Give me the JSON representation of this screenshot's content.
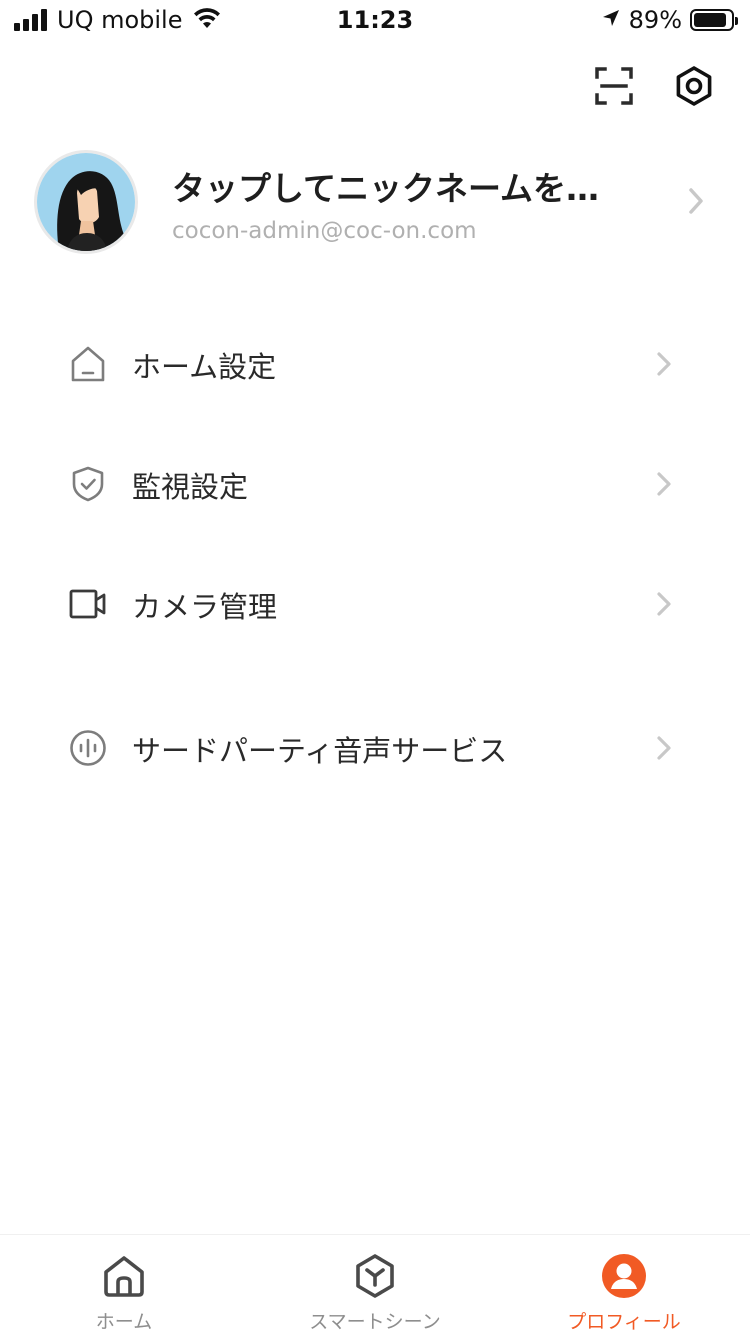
{
  "status_bar": {
    "carrier": "UQ mobile",
    "time": "11:23",
    "battery_percent": "89%",
    "battery_level": 0.89,
    "icons": [
      "signal-icon",
      "wifi-icon",
      "location-arrow-icon",
      "battery-icon"
    ]
  },
  "top_actions": {
    "scan_icon": "scan-icon",
    "settings_icon": "settings-hexagon-icon"
  },
  "profile": {
    "nickname": "タップしてニックネームを…",
    "email": "cocon-admin@coc-on.com",
    "avatar_icon": "avatar"
  },
  "menu": {
    "items": [
      {
        "label": "ホーム設定",
        "icon": "home-outline-icon"
      },
      {
        "label": "監視設定",
        "icon": "shield-check-icon"
      },
      {
        "label": "カメラ管理",
        "icon": "video-camera-icon"
      },
      {
        "label": "サードパーティ音声サービス",
        "icon": "voice-wave-icon"
      }
    ]
  },
  "tab_bar": {
    "tabs": [
      {
        "label": "ホーム",
        "icon": "home-icon",
        "active": false
      },
      {
        "label": "スマートシーン",
        "icon": "smart-scene-icon",
        "active": false
      },
      {
        "label": "プロフィール",
        "icon": "profile-icon",
        "active": true
      }
    ],
    "active_color": "#f15a24",
    "inactive_color": "#8e8e8e"
  }
}
